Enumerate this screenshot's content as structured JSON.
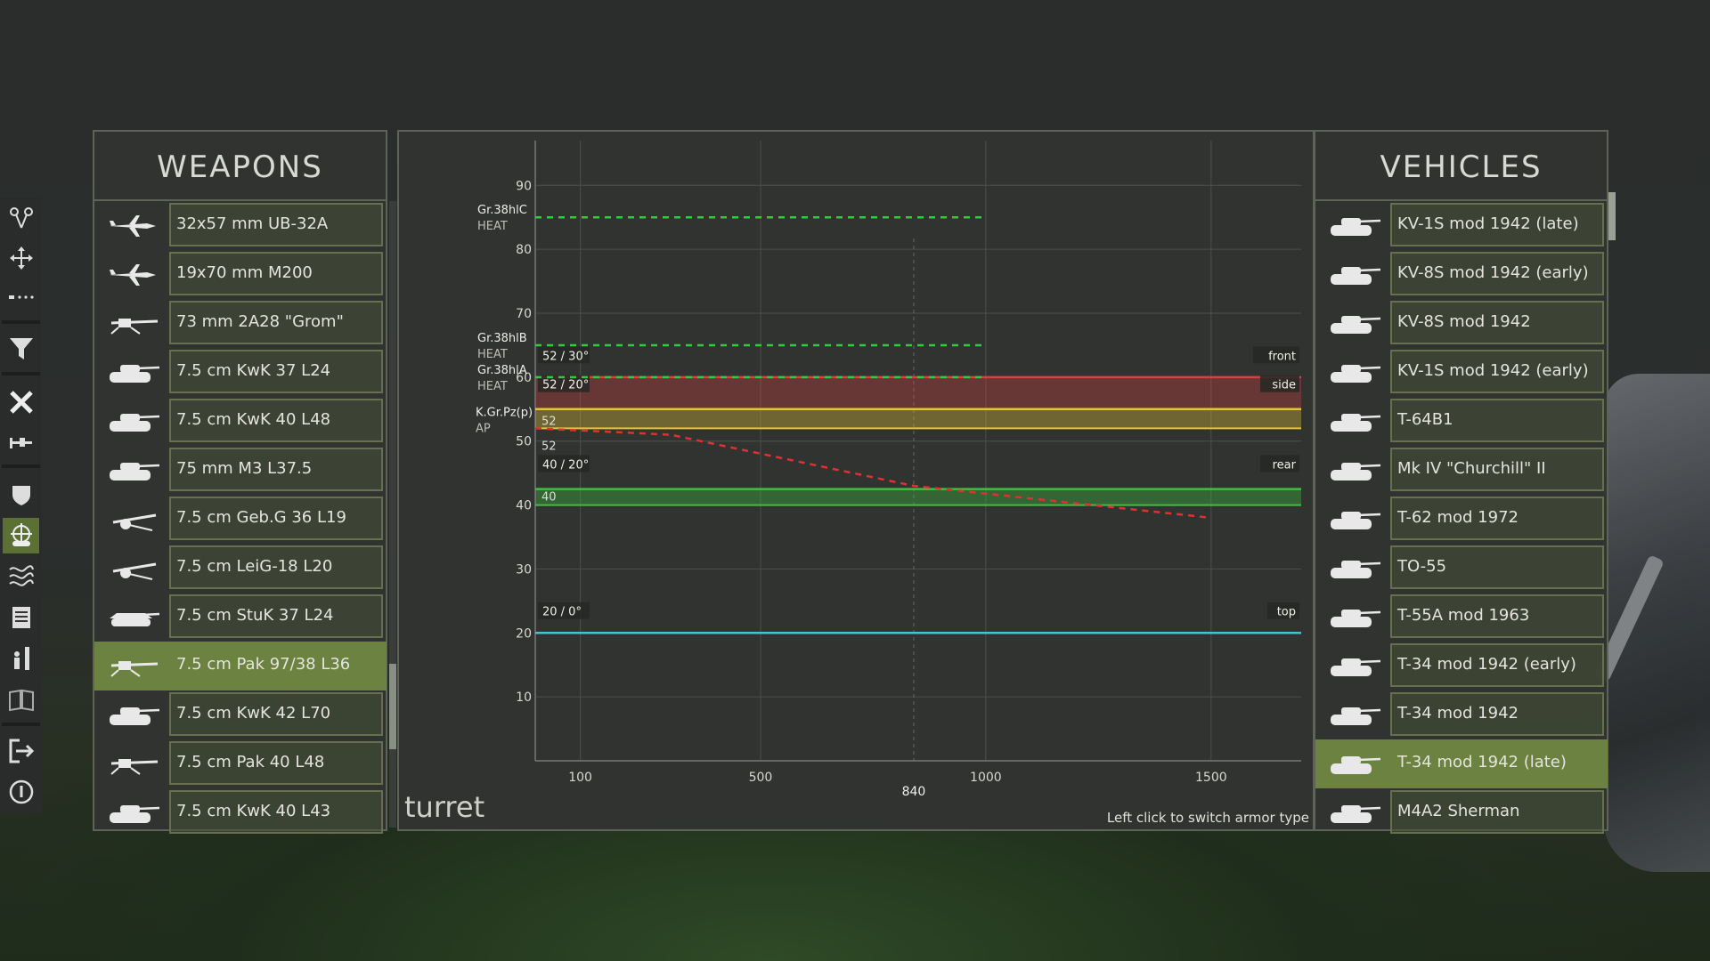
{
  "weapons": {
    "title": "WEAPONS",
    "items": [
      {
        "label": "32x57 mm UB-32A",
        "icon": "aircraft-icon"
      },
      {
        "label": "19x70 mm M200",
        "icon": "aircraft-icon"
      },
      {
        "label": "73 mm 2A28 \"Grom\"",
        "icon": "gun-icon"
      },
      {
        "label": "7.5 cm KwK 37 L24",
        "icon": "tank-icon"
      },
      {
        "label": "7.5 cm KwK 40 L48",
        "icon": "tank-icon"
      },
      {
        "label": "75 mm M3 L37.5",
        "icon": "tank-icon"
      },
      {
        "label": "7.5 cm Geb.G 36 L19",
        "icon": "field-gun-icon"
      },
      {
        "label": "7.5 cm LeiG-18 L20",
        "icon": "field-gun-icon"
      },
      {
        "label": "7.5 cm StuK 37 L24",
        "icon": "assault-gun-icon"
      },
      {
        "label": "7.5 cm Pak 97/38 L36",
        "icon": "antitank-gun-icon",
        "selected": true
      },
      {
        "label": "7.5 cm KwK 42 L70",
        "icon": "tank-icon"
      },
      {
        "label": "7.5 cm Pak 40 L48",
        "icon": "antitank-gun-icon"
      },
      {
        "label": "7.5 cm KwK 40 L43",
        "icon": "tank-icon"
      }
    ]
  },
  "vehicles": {
    "title": "VEHICLES",
    "items": [
      {
        "label": "KV-1S mod 1942 (late)"
      },
      {
        "label": "KV-8S mod 1942 (early)"
      },
      {
        "label": "KV-8S mod 1942"
      },
      {
        "label": "KV-1S mod 1942 (early)"
      },
      {
        "label": "T-64B1"
      },
      {
        "label": "Mk IV \"Churchill\" II"
      },
      {
        "label": "T-62 mod 1972"
      },
      {
        "label": "TO-55"
      },
      {
        "label": "T-55A mod 1963"
      },
      {
        "label": "T-34 mod 1942 (early)"
      },
      {
        "label": "T-34 mod 1942"
      },
      {
        "label": "T-34 mod 1942 (late)",
        "selected": true
      },
      {
        "label": "M4A2 Sherman"
      }
    ]
  },
  "chart": {
    "section_label": "turret",
    "hint": "Left click to switch armor type"
  },
  "chart_data": {
    "type": "line",
    "xlim": [
      0,
      1700
    ],
    "ylim": [
      0,
      97
    ],
    "x_ticks": [
      100,
      500,
      1000,
      1500
    ],
    "x_marker": {
      "x": 840,
      "label": "840"
    },
    "y_ticks": [
      10,
      20,
      30,
      40,
      50,
      60,
      70,
      80,
      90
    ],
    "ammo": [
      {
        "name": "Gr.38hlC",
        "type": "HEAT",
        "penetration": 85,
        "max_range": 1000,
        "color": "#2ecc40"
      },
      {
        "name": "Gr.38hlB",
        "type": "HEAT",
        "penetration": 65,
        "max_range": 1000,
        "color": "#2ecc40"
      },
      {
        "name": "Gr.38hlA",
        "type": "HEAT",
        "penetration": 60,
        "max_range": 1000,
        "color": "#2ecc40"
      },
      {
        "name": "K.Gr.Pz(p)",
        "type": "AP",
        "points": [
          [
            0,
            52
          ],
          [
            300,
            51
          ],
          [
            840,
            43
          ],
          [
            1500,
            38
          ]
        ],
        "color": "#e03030"
      }
    ],
    "armor": [
      {
        "side": "front",
        "label": "52 / 30°",
        "value": 60,
        "color": "#d94040"
      },
      {
        "side": "side",
        "label": "52 / 20°",
        "value": 55,
        "low": 52,
        "low_label": "52",
        "band_label": "52",
        "color": "#e6c43a"
      },
      {
        "side": "rear",
        "label": "40 / 20°",
        "value": 42.5,
        "low": 40,
        "low_label": "40",
        "color": "#3fbf3f"
      },
      {
        "side": "top",
        "label": "20 / 0°",
        "value": 20,
        "color": "#3ec6d8"
      }
    ]
  },
  "toolbar": {
    "items": [
      "measure-icon",
      "move-icon",
      "dotted-line-icon",
      "filter-icon",
      "close-x-icon",
      "weapon-info-icon",
      "shield-icon",
      "target-tank-icon",
      "terrain-icon",
      "list-icon",
      "infantry-icon",
      "book-icon",
      "exit-icon",
      "info-icon"
    ]
  }
}
